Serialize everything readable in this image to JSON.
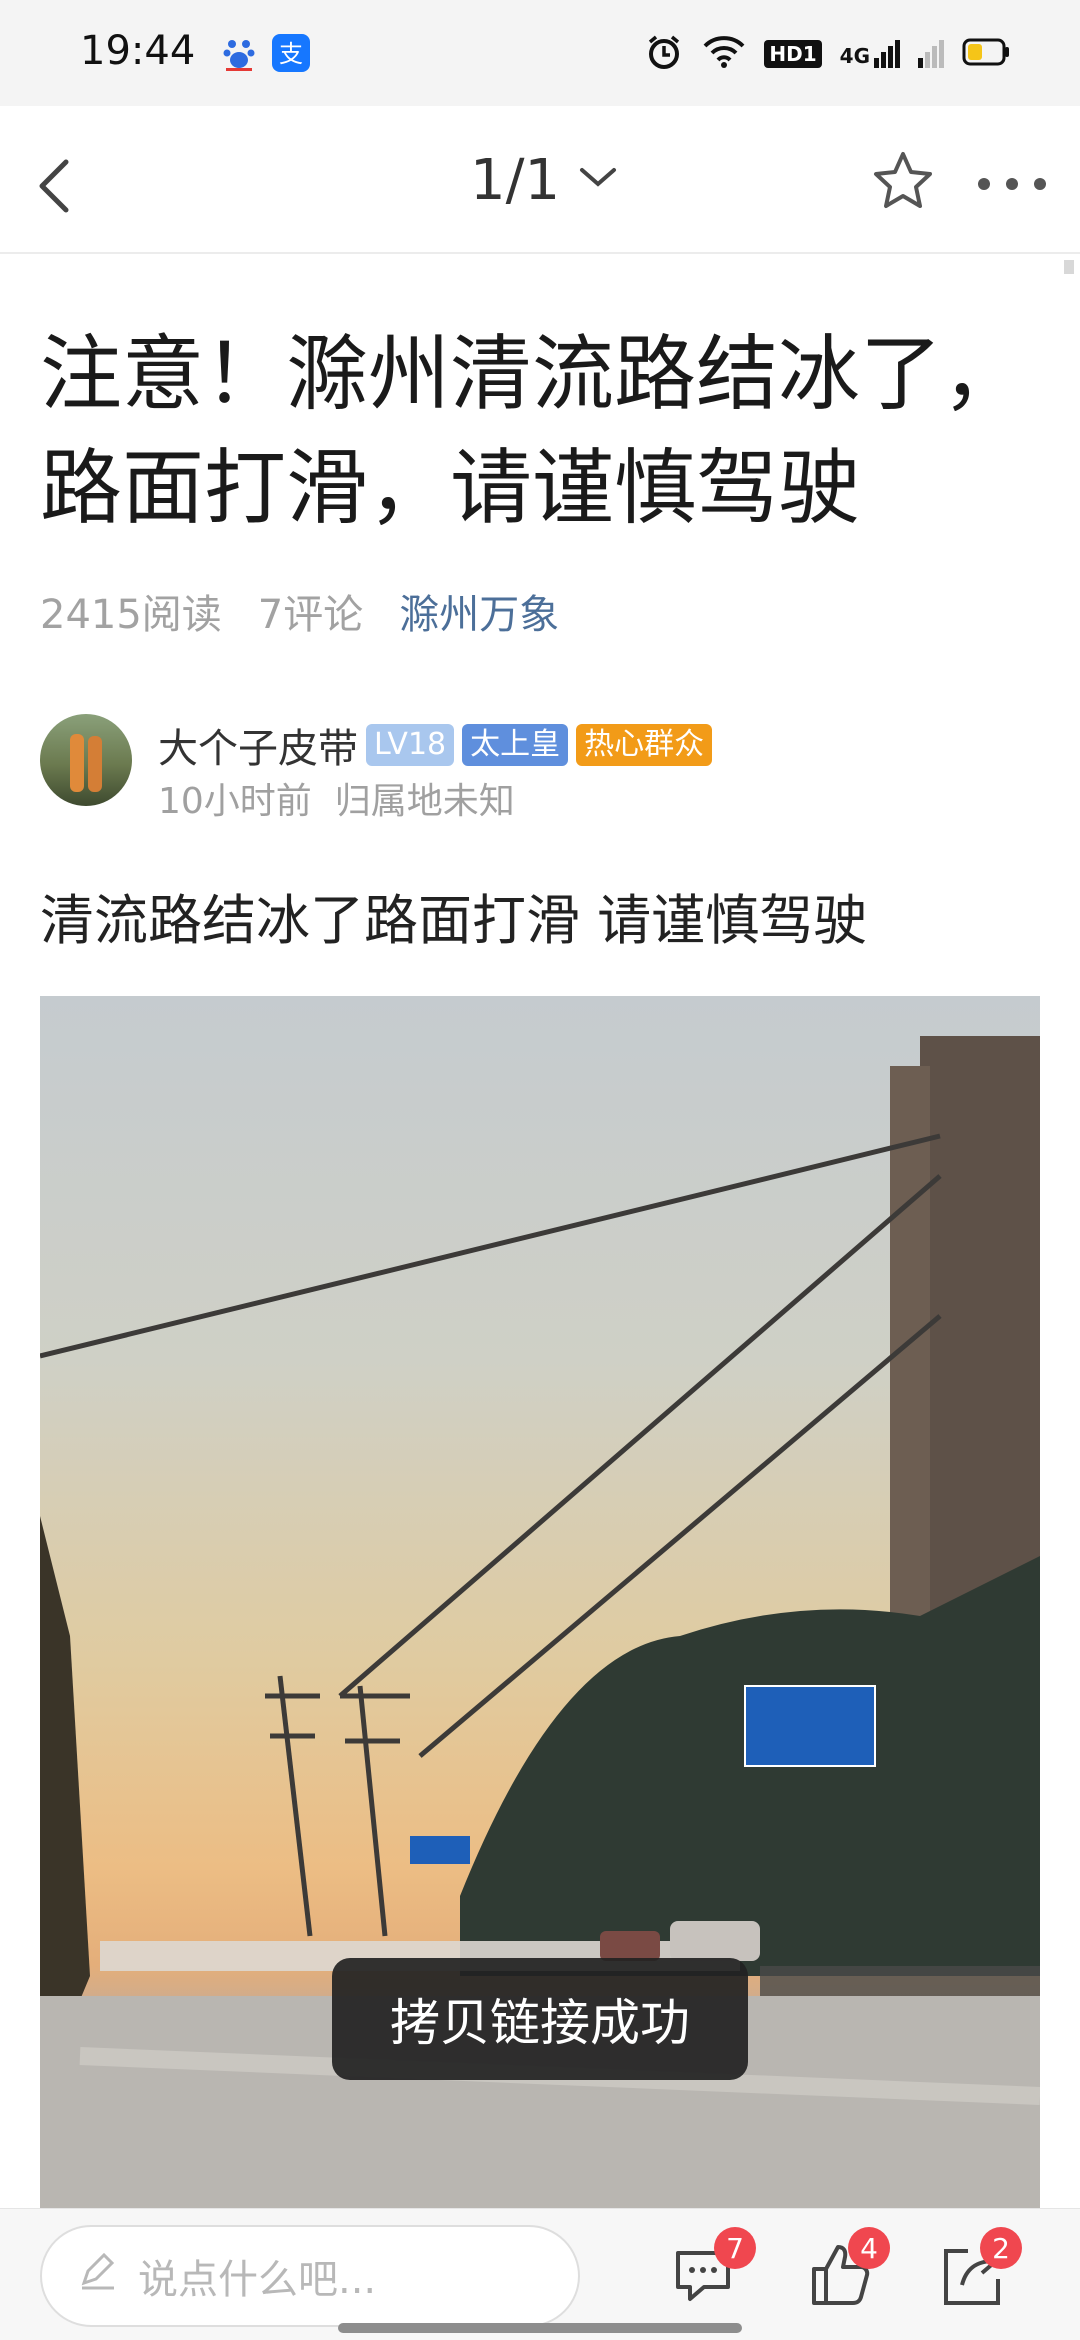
{
  "status_bar": {
    "time": "19:44",
    "icons": [
      "baidu-icon",
      "alipay-icon",
      "alarm-icon",
      "wifi-icon",
      "hd-icon",
      "signal-4g-icon",
      "signal-icon",
      "battery-icon"
    ],
    "hd_label": "HD1",
    "net_label": "4G"
  },
  "nav": {
    "page_indicator": "1/1",
    "icons": [
      "back-arrow-icon",
      "chevron-down-icon",
      "star-icon",
      "more-icon"
    ]
  },
  "article": {
    "title": "注意！滁州清流路结冰了，路面打滑，请谨慎驾驶",
    "reads": "2415阅读",
    "comments": "7评论",
    "category": "滁州万象",
    "author": {
      "name": "大个子皮带",
      "level": "LV18",
      "title_badge": "太上皇",
      "hot_badge": "热心群众",
      "time": "10小时前",
      "location": "归属地未知"
    },
    "body": "清流路结冰了路面打滑 请谨慎驾驶",
    "photo_description_icon": "road-photo"
  },
  "toast": "拷贝链接成功",
  "bottom_bar": {
    "input_placeholder": "说点什么吧...",
    "comment_count": "7",
    "like_count": "4",
    "share_count": "2",
    "icons": [
      "pencil-icon",
      "comment-icon",
      "thumbs-up-icon",
      "share-icon"
    ]
  },
  "colors": {
    "category": "#4c6f99",
    "level_badge": "#a9c7ee",
    "title_badge": "#5f8fdd",
    "hot_badge": "#f29b18",
    "notify_dot": "#f0474f"
  }
}
